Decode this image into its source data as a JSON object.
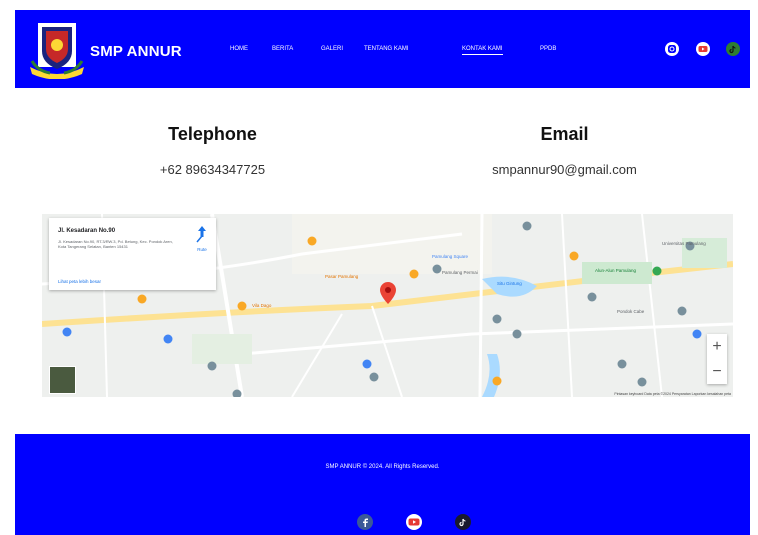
{
  "header": {
    "brand": "SMP ANNUR",
    "nav": [
      {
        "label": "HOME"
      },
      {
        "label": "BERITA"
      },
      {
        "label": "GALERI"
      },
      {
        "label": "TENTANG KAMI"
      },
      {
        "label": "KONTAK KAMI",
        "active": true
      },
      {
        "label": "PPDB"
      }
    ],
    "social_icons": [
      "instagram-icon",
      "youtube-icon",
      "tiktok-icon"
    ]
  },
  "contact": {
    "telephone_title": "Telephone",
    "telephone_value": "+62 89634347725",
    "email_title": "Email",
    "email_value": "smpannur90@gmail.com"
  },
  "map": {
    "place_title": "Jl. Kesadaran No.90",
    "place_address": "Jl. Kesadaran No.90, RT.3/RW.3, Pd. Betung, Kec. Pondok Aren, Kota Tangerang Selatan, Banten 15431",
    "directions_label": "Rute",
    "larger_map_link": "Lihat peta lebih besar",
    "labels": [
      "Pamulang Square",
      "Pamulang Permai",
      "Situ Gintung",
      "Vila Dago",
      "Universitas Pamulang",
      "Alun-Alun Pamulang",
      "Pasar Pamulang",
      "Pondok Cabe"
    ],
    "attribution": "Pintasan keyboard  Data peta ©2024  Persyaratan  Laporkan kesalahan peta"
  },
  "footer": {
    "copyright": "SMP ANNUR © 2024. All Rights Reserved.",
    "social_icons": [
      "facebook-icon",
      "youtube-icon",
      "tiktok-icon"
    ]
  },
  "colors": {
    "brand_blue": "#0000ff",
    "map_pin_red": "#ea4335",
    "poi_orange": "#f9a825",
    "poi_blue": "#4285f4",
    "poi_green": "#34a853"
  }
}
